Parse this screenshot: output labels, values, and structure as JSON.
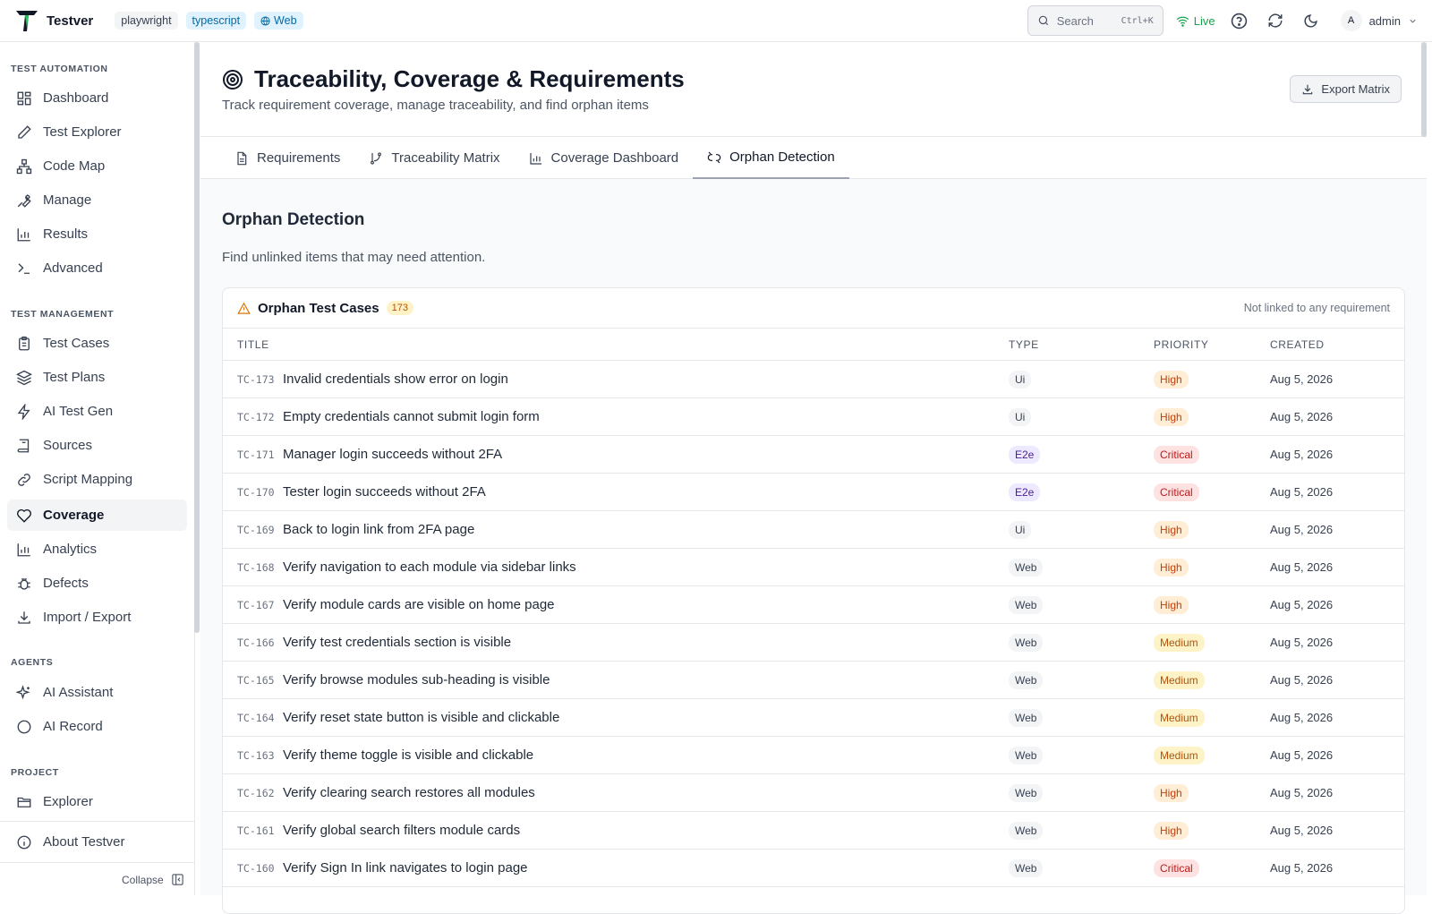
{
  "app": {
    "name": "Testver"
  },
  "header": {
    "chips": [
      "playwright",
      "typescript",
      "Web"
    ],
    "search": {
      "label": "Search",
      "shortcut": "Ctrl+K"
    },
    "live": "Live",
    "user": {
      "initial": "A",
      "name": "admin"
    }
  },
  "sidebar": {
    "sections": [
      {
        "title": "TEST AUTOMATION",
        "items": [
          {
            "label": "Dashboard",
            "icon": "dashboard-icon"
          },
          {
            "label": "Test Explorer",
            "icon": "pencil-icon"
          },
          {
            "label": "Code Map",
            "icon": "network-icon"
          },
          {
            "label": "Manage",
            "icon": "wrench-icon"
          },
          {
            "label": "Results",
            "icon": "bar-chart-icon"
          },
          {
            "label": "Advanced",
            "icon": "terminal-icon"
          }
        ]
      },
      {
        "title": "TEST MANAGEMENT",
        "items": [
          {
            "label": "Test Cases",
            "icon": "clipboard-icon"
          },
          {
            "label": "Test Plans",
            "icon": "layers-icon"
          },
          {
            "label": "AI Test Gen",
            "icon": "bolt-icon"
          },
          {
            "label": "Sources",
            "icon": "book-icon"
          },
          {
            "label": "Script Mapping",
            "icon": "link-icon"
          },
          {
            "label": "Coverage",
            "icon": "heart-icon",
            "active": true
          },
          {
            "label": "Analytics",
            "icon": "bar-chart-icon"
          },
          {
            "label": "Defects",
            "icon": "bug-icon"
          },
          {
            "label": "Import / Export",
            "icon": "download-icon"
          }
        ]
      },
      {
        "title": "AGENTS",
        "items": [
          {
            "label": "AI Assistant",
            "icon": "sparkles-icon"
          },
          {
            "label": "AI Record",
            "icon": "circle-icon"
          }
        ]
      },
      {
        "title": "PROJECT",
        "items": [
          {
            "label": "Explorer",
            "icon": "folder-icon"
          }
        ]
      }
    ],
    "about": "About Testver",
    "collapse": "Collapse"
  },
  "page": {
    "title": "Traceability, Coverage & Requirements",
    "subtitle": "Track requirement coverage, manage traceability, and find orphan items",
    "export_label": "Export Matrix",
    "tabs": [
      {
        "label": "Requirements",
        "icon": "document-icon"
      },
      {
        "label": "Traceability Matrix",
        "icon": "git-branch-icon"
      },
      {
        "label": "Coverage Dashboard",
        "icon": "bar-chart-icon"
      },
      {
        "label": "Orphan Detection",
        "icon": "unlink-icon",
        "active": true
      }
    ],
    "section_title": "Orphan Detection",
    "section_desc": "Find unlinked items that may need attention."
  },
  "orphans": {
    "title": "Orphan Test Cases",
    "count": "173",
    "note": "Not linked to any requirement",
    "columns": [
      "TITLE",
      "TYPE",
      "PRIORITY",
      "CREATED"
    ],
    "rows": [
      {
        "id": "TC-173",
        "title": "Invalid credentials show error on login",
        "type": "Ui",
        "priority": "High",
        "created": "Aug 5, 2026"
      },
      {
        "id": "TC-172",
        "title": "Empty credentials cannot submit login form",
        "type": "Ui",
        "priority": "High",
        "created": "Aug 5, 2026"
      },
      {
        "id": "TC-171",
        "title": "Manager login succeeds without 2FA",
        "type": "E2e",
        "priority": "Critical",
        "created": "Aug 5, 2026"
      },
      {
        "id": "TC-170",
        "title": "Tester login succeeds without 2FA",
        "type": "E2e",
        "priority": "Critical",
        "created": "Aug 5, 2026"
      },
      {
        "id": "TC-169",
        "title": "Back to login link from 2FA page",
        "type": "Ui",
        "priority": "High",
        "created": "Aug 5, 2026"
      },
      {
        "id": "TC-168",
        "title": "Verify navigation to each module via sidebar links",
        "type": "Web",
        "priority": "High",
        "created": "Aug 5, 2026"
      },
      {
        "id": "TC-167",
        "title": "Verify module cards are visible on home page",
        "type": "Web",
        "priority": "High",
        "created": "Aug 5, 2026"
      },
      {
        "id": "TC-166",
        "title": "Verify test credentials section is visible",
        "type": "Web",
        "priority": "Medium",
        "created": "Aug 5, 2026"
      },
      {
        "id": "TC-165",
        "title": "Verify browse modules sub-heading is visible",
        "type": "Web",
        "priority": "Medium",
        "created": "Aug 5, 2026"
      },
      {
        "id": "TC-164",
        "title": "Verify reset state button is visible and clickable",
        "type": "Web",
        "priority": "Medium",
        "created": "Aug 5, 2026"
      },
      {
        "id": "TC-163",
        "title": "Verify theme toggle is visible and clickable",
        "type": "Web",
        "priority": "Medium",
        "created": "Aug 5, 2026"
      },
      {
        "id": "TC-162",
        "title": "Verify clearing search restores all modules",
        "type": "Web",
        "priority": "High",
        "created": "Aug 5, 2026"
      },
      {
        "id": "TC-161",
        "title": "Verify global search filters module cards",
        "type": "Web",
        "priority": "High",
        "created": "Aug 5, 2026"
      },
      {
        "id": "TC-160",
        "title": "Verify Sign In link navigates to login page",
        "type": "Web",
        "priority": "Critical",
        "created": "Aug 5, 2026"
      }
    ]
  }
}
